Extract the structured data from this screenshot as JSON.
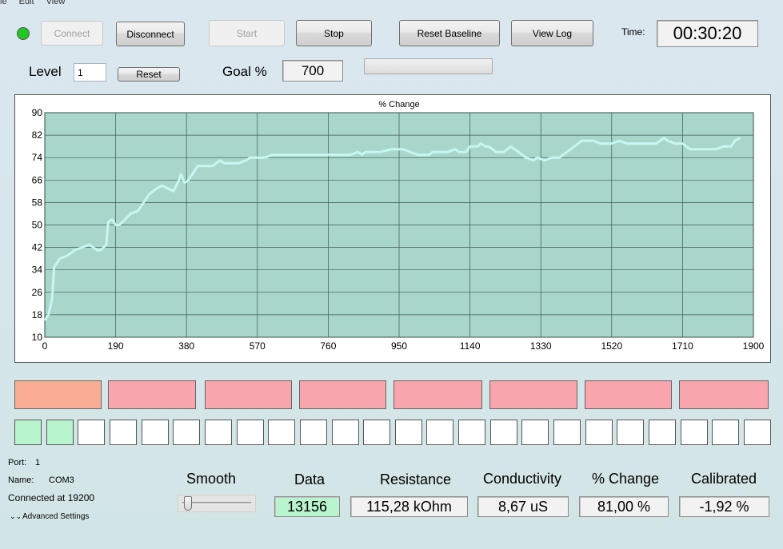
{
  "menu": [
    "le",
    "Edit",
    "View"
  ],
  "status_led_color": "#22c722",
  "toolbar": {
    "connect": "Connect",
    "disconnect": "Disconnect",
    "start": "Start",
    "stop": "Stop",
    "reset_baseline": "Reset Baseline",
    "view_log": "View Log",
    "time_label": "Time:",
    "time_value": "00:30:20"
  },
  "level": {
    "label": "Level",
    "value": "1",
    "reset": "Reset"
  },
  "goal": {
    "label": "Goal %",
    "value": "700",
    "progress": 0
  },
  "chart_data": {
    "type": "line",
    "title": "% Change",
    "xlabel": "",
    "ylabel": "",
    "xlim": [
      0,
      1900
    ],
    "ylim": [
      10,
      90
    ],
    "xticks": [
      0,
      190,
      380,
      570,
      760,
      950,
      1140,
      1330,
      1520,
      1710,
      1900
    ],
    "yticks": [
      10,
      18,
      26,
      34,
      42,
      50,
      58,
      66,
      74,
      82,
      90
    ],
    "grid": true,
    "colors": {
      "background": "#a8d6ca",
      "line": "#c6f7f1",
      "grid": "#3a5a50"
    },
    "series": [
      {
        "x": [
          0,
          10,
          20,
          25,
          40,
          60,
          80,
          100,
          120,
          140,
          150,
          165,
          170,
          180,
          190,
          200,
          215,
          230,
          250,
          270,
          280,
          300,
          315,
          330,
          345,
          360,
          365,
          375,
          385,
          400,
          410,
          430,
          450,
          470,
          480,
          500,
          520,
          540,
          550,
          560,
          570,
          590,
          610,
          640,
          660,
          680,
          700,
          720,
          740,
          760,
          780,
          800,
          820,
          840,
          850,
          860,
          880,
          890,
          900,
          930,
          950,
          960,
          980,
          1000,
          1030,
          1040,
          1060,
          1080,
          1100,
          1110,
          1130,
          1140,
          1160,
          1170,
          1180,
          1190,
          1210,
          1230,
          1250,
          1270,
          1290,
          1310,
          1320,
          1340,
          1360,
          1380,
          1400,
          1420,
          1440,
          1450,
          1470,
          1490,
          1520,
          1540,
          1560,
          1580,
          1600,
          1620,
          1640,
          1650,
          1660,
          1670,
          1690,
          1710,
          1730,
          1750,
          1760,
          1780,
          1800,
          1820,
          1840,
          1850,
          1865
        ],
        "y": [
          16,
          18,
          24,
          35,
          38,
          39,
          41,
          42,
          43,
          41,
          41,
          43,
          51,
          52,
          50,
          50,
          52,
          54,
          55,
          59,
          61,
          63,
          64,
          63,
          62,
          66,
          68,
          65,
          66,
          69,
          71,
          71,
          71,
          73,
          72,
          72,
          72,
          73,
          74,
          74,
          74,
          74,
          75,
          75,
          75,
          75,
          75,
          75,
          75,
          75,
          75,
          75,
          75,
          76,
          75,
          76,
          76,
          76,
          76,
          77,
          77,
          77,
          76,
          75,
          75,
          76,
          76,
          76,
          77,
          76,
          76,
          78,
          78,
          79,
          78,
          78,
          76,
          76,
          78,
          76,
          74,
          73,
          74,
          73,
          74,
          74,
          76,
          78,
          80,
          80,
          80,
          79,
          79,
          80,
          79,
          79,
          79,
          79,
          79,
          80,
          81,
          80,
          79,
          79,
          77,
          77,
          77,
          77,
          77,
          78,
          78,
          80,
          81
        ]
      }
    ]
  },
  "indicators_top": [
    {
      "color": "#f8ad93"
    },
    {
      "color": "#f8a5ae"
    },
    {
      "color": "#f8a5ae"
    },
    {
      "color": "#f8a5ae"
    },
    {
      "color": "#f8a5ae"
    },
    {
      "color": "#f8a5ae"
    },
    {
      "color": "#f8a5ae"
    },
    {
      "color": "#f8a5ae"
    }
  ],
  "indicators_bottom_active": 2,
  "indicators_bottom_total": 24,
  "indicator_active_color": "#b8f5cf",
  "port": {
    "port_label": "Port:",
    "port_value": "1",
    "name_label": "Name:",
    "name_value": "COM3",
    "status": "Connected at 19200",
    "advanced": "Advanced Settings"
  },
  "smooth": {
    "label": "Smooth",
    "level": 0
  },
  "readouts": [
    {
      "label": "Data",
      "value": "13156",
      "highlight": "#b8f5cf"
    },
    {
      "label": "Resistance",
      "value": "115,28 kOhm"
    },
    {
      "label": "Conductivity",
      "value": "8,67 uS"
    },
    {
      "label": "% Change",
      "value": "81,00 %"
    },
    {
      "label": "Calibrated",
      "value": "-1,92 %"
    }
  ]
}
